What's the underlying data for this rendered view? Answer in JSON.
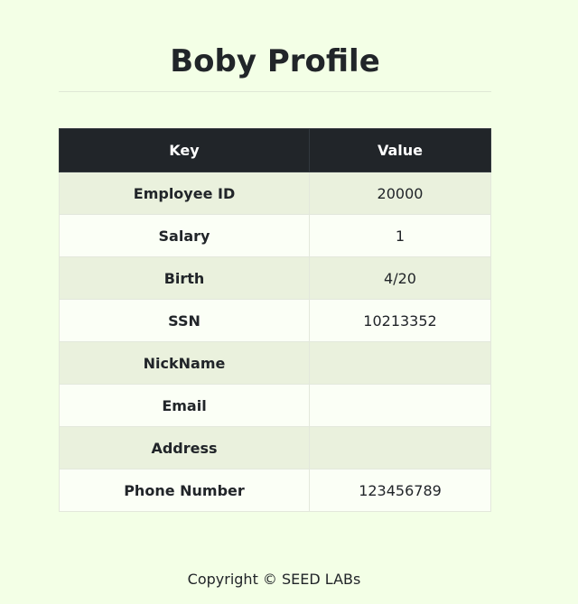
{
  "page": {
    "title": "Boby Profile"
  },
  "table": {
    "headers": {
      "key": "Key",
      "value": "Value"
    },
    "rows": [
      {
        "key": "Employee ID",
        "value": "20000"
      },
      {
        "key": "Salary",
        "value": "1"
      },
      {
        "key": "Birth",
        "value": "4/20"
      },
      {
        "key": "SSN",
        "value": "10213352"
      },
      {
        "key": "NickName",
        "value": ""
      },
      {
        "key": "Email",
        "value": ""
      },
      {
        "key": "Address",
        "value": ""
      },
      {
        "key": "Phone Number",
        "value": "123456789"
      }
    ]
  },
  "footer": {
    "text": "Copyright © SEED LABs"
  }
}
